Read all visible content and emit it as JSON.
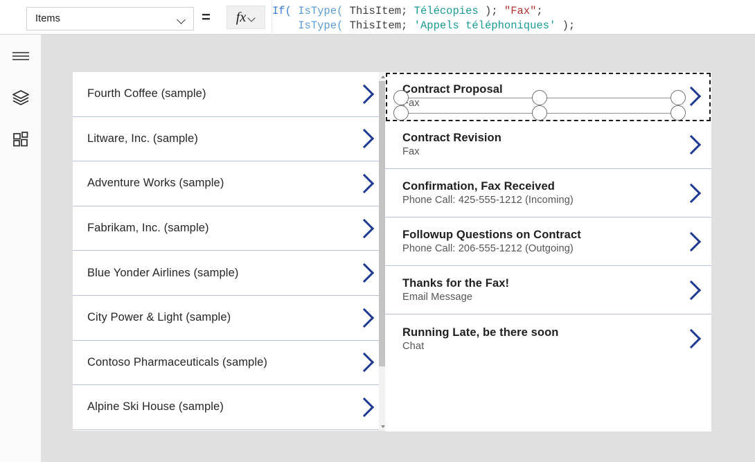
{
  "formula_bar": {
    "property_dropdown": {
      "value": "Items",
      "icon": "chevron-down-icon"
    },
    "equals": "=",
    "fx_button": {
      "glyph": "fx",
      "icon": "chevron-down-icon"
    },
    "formula_lines": [
      {
        "tokens": [
          {
            "text": "If(",
            "type": "fn"
          },
          {
            "text": " ",
            "type": "plain"
          },
          {
            "text": "IsType(",
            "type": "fn2"
          },
          {
            "text": " ThisItem; ",
            "type": "arg"
          },
          {
            "text": "Télécopies",
            "type": "type"
          },
          {
            "text": " ); ",
            "type": "punc"
          },
          {
            "text": "\"Fax\"",
            "type": "str"
          },
          {
            "text": ";",
            "type": "punc"
          }
        ]
      },
      {
        "tokens": [
          {
            "text": "    ",
            "type": "plain"
          },
          {
            "text": "IsType(",
            "type": "fn2"
          },
          {
            "text": " ThisItem; ",
            "type": "arg"
          },
          {
            "text": "'Appels téléphoniques'",
            "type": "type"
          },
          {
            "text": " );",
            "type": "punc"
          }
        ]
      }
    ],
    "formula_plain": "If( IsType( ThisItem; Télécopies ); \"Fax\";\n    IsType( ThisItem; 'Appels téléphoniques' );"
  },
  "rail": {
    "items": [
      {
        "icon": "hamburger-menu-icon",
        "name": "menu"
      },
      {
        "icon": "layers-icon",
        "name": "tree-view"
      },
      {
        "icon": "components-grid-icon",
        "name": "components"
      }
    ]
  },
  "left_gallery": {
    "items": [
      {
        "title": "Fourth Coffee (sample)",
        "chevron": "chevron-right-icon"
      },
      {
        "title": "Litware, Inc. (sample)",
        "chevron": "chevron-right-icon"
      },
      {
        "title": "Adventure Works (sample)",
        "chevron": "chevron-right-icon"
      },
      {
        "title": "Fabrikam, Inc. (sample)",
        "chevron": "chevron-right-icon"
      },
      {
        "title": "Blue Yonder Airlines (sample)",
        "chevron": "chevron-right-icon"
      },
      {
        "title": "City Power & Light (sample)",
        "chevron": "chevron-right-icon"
      },
      {
        "title": "Contoso Pharmaceuticals (sample)",
        "chevron": "chevron-right-icon"
      },
      {
        "title": "Alpine Ski House (sample)",
        "chevron": "chevron-right-icon"
      }
    ],
    "scrollbar": {
      "up_icon": "scroll-up-arrow-icon",
      "down_icon": "scroll-down-arrow-icon"
    }
  },
  "right_gallery": {
    "items": [
      {
        "title": "Contract Proposal",
        "subtitle": "Fax",
        "selected": true,
        "chevron": "chevron-right-icon"
      },
      {
        "title": "Contract Revision",
        "subtitle": "Fax",
        "selected": false,
        "chevron": "chevron-right-icon"
      },
      {
        "title": "Confirmation, Fax Received",
        "subtitle": "Phone Call: 425-555-1212 (Incoming)",
        "selected": false,
        "chevron": "chevron-right-icon"
      },
      {
        "title": "Followup Questions on Contract",
        "subtitle": "Phone Call: 206-555-1212 (Outgoing)",
        "selected": false,
        "chevron": "chevron-right-icon"
      },
      {
        "title": "Thanks for the Fax!",
        "subtitle": "Email Message",
        "selected": false,
        "chevron": "chevron-right-icon"
      },
      {
        "title": "Running Late, be there soon",
        "subtitle": "Chat",
        "selected": false,
        "chevron": "chevron-right-icon"
      }
    ]
  },
  "colors": {
    "canvas_background": "#e0e0e0",
    "gallery_background": "#ffffff",
    "separator": "#b9c0e0",
    "chevron": "#1f3a93",
    "selection_border": "#1a1a1a",
    "handle_fill": "#ffffff",
    "handle_stroke": "#6d6d6d",
    "token_function": "#3a7fd5",
    "token_type": "#1a9a94",
    "token_string": "#b5302f"
  }
}
